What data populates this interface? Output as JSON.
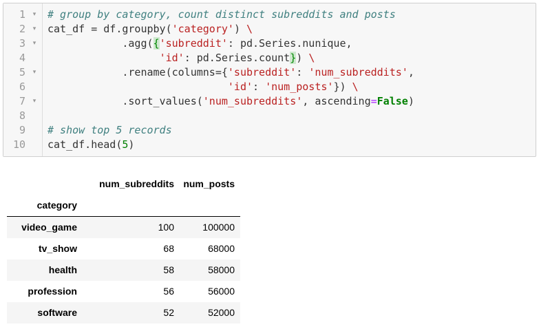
{
  "code_cell": {
    "lines": [
      {
        "num": "1",
        "fold": "▾",
        "tokens": [
          {
            "t": "# group by category, count distinct subreddits and posts",
            "c": "cm"
          }
        ]
      },
      {
        "num": "2",
        "fold": "▾",
        "tokens": [
          {
            "t": "cat_df = df.groupby(",
            "c": "bk"
          },
          {
            "t": "'category'",
            "c": "st"
          },
          {
            "t": ") ",
            "c": "bk"
          },
          {
            "t": "\\",
            "c": "st"
          }
        ]
      },
      {
        "num": "3",
        "fold": "▾",
        "tokens": [
          {
            "t": "            .agg(",
            "c": "bk"
          },
          {
            "t": "{",
            "c": "bm"
          },
          {
            "t": "'subreddit'",
            "c": "st"
          },
          {
            "t": ": pd.Series.nunique,",
            "c": "bk"
          }
        ]
      },
      {
        "num": "4",
        "fold": "",
        "tokens": [
          {
            "t": "                  ",
            "c": "bk"
          },
          {
            "t": "'id'",
            "c": "st"
          },
          {
            "t": ": pd.Series.count",
            "c": "bk"
          },
          {
            "t": "}",
            "c": "bm"
          },
          {
            "t": ") ",
            "c": "bk"
          },
          {
            "t": "\\",
            "c": "st"
          }
        ]
      },
      {
        "num": "5",
        "fold": "▾",
        "tokens": [
          {
            "t": "            .rename(columns={",
            "c": "bk"
          },
          {
            "t": "'subreddit'",
            "c": "st"
          },
          {
            "t": ": ",
            "c": "bk"
          },
          {
            "t": "'num_subreddits'",
            "c": "st"
          },
          {
            "t": ",",
            "c": "bk"
          }
        ]
      },
      {
        "num": "6",
        "fold": "",
        "tokens": [
          {
            "t": "                             ",
            "c": "bk"
          },
          {
            "t": "'id'",
            "c": "st"
          },
          {
            "t": ": ",
            "c": "bk"
          },
          {
            "t": "'num_posts'",
            "c": "st"
          },
          {
            "t": "}) ",
            "c": "bk"
          },
          {
            "t": "\\",
            "c": "st"
          }
        ]
      },
      {
        "num": "7",
        "fold": "▾",
        "tokens": [
          {
            "t": "            .sort_values(",
            "c": "bk"
          },
          {
            "t": "'num_subreddits'",
            "c": "st"
          },
          {
            "t": ", ascending",
            "c": "bk"
          },
          {
            "t": "=",
            "c": "op"
          },
          {
            "t": "False",
            "c": "kw"
          },
          {
            "t": ")",
            "c": "bk"
          }
        ]
      },
      {
        "num": "8",
        "fold": "",
        "tokens": []
      },
      {
        "num": "9",
        "fold": "",
        "tokens": [
          {
            "t": "# show top 5 records",
            "c": "cm"
          }
        ]
      },
      {
        "num": "10",
        "fold": "",
        "tokens": [
          {
            "t": "cat_df.head(",
            "c": "bk"
          },
          {
            "t": "5",
            "c": "nm"
          },
          {
            "t": ")",
            "c": "bk"
          }
        ]
      }
    ]
  },
  "output_table": {
    "columns": [
      "num_subreddits",
      "num_posts"
    ],
    "index_name": "category",
    "rows": [
      {
        "index": "video_game",
        "values": [
          "100",
          "100000"
        ]
      },
      {
        "index": "tv_show",
        "values": [
          "68",
          "68000"
        ]
      },
      {
        "index": "health",
        "values": [
          "58",
          "58000"
        ]
      },
      {
        "index": "profession",
        "values": [
          "56",
          "56000"
        ]
      },
      {
        "index": "software",
        "values": [
          "52",
          "52000"
        ]
      }
    ]
  },
  "colors": {
    "comment": "#408080",
    "string": "#ba2121",
    "number": "#008000",
    "keyword": "#008000",
    "operator": "#aa22ff",
    "bracket_match_bg": "#cfe8cf",
    "cell_bg": "#f7f7f7",
    "row_stripe": "#f5f5f5"
  }
}
